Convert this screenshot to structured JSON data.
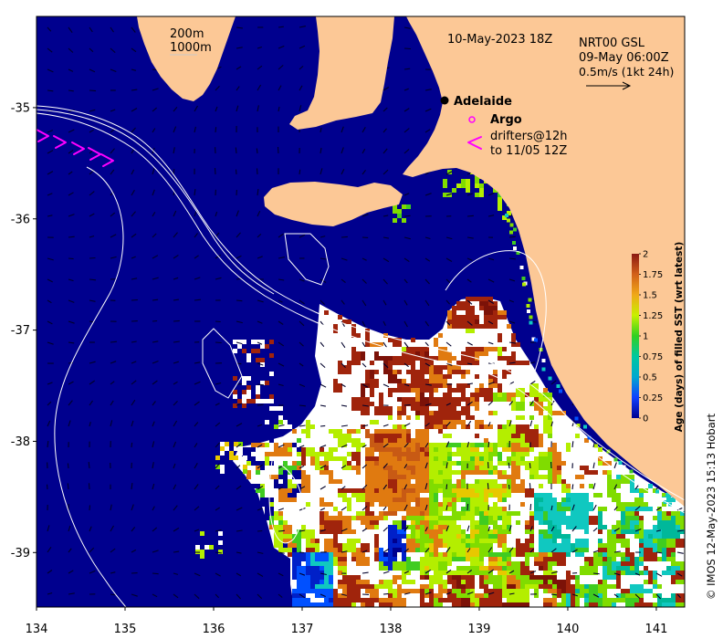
{
  "figure": {
    "date_label": "10-May-2023 18Z",
    "credit": "© IMOS 12-May-2023 15:13 Hobart"
  },
  "isobath_legend": {
    "shallow": "200m",
    "deep": "1000m"
  },
  "currents_legend": {
    "product": "NRT00 GSL",
    "time": "09-May 06:00Z",
    "scale": "0.5m/s (1kt 24h)"
  },
  "places": {
    "city": "Adelaide"
  },
  "floats_legend": {
    "argo": "Argo",
    "drifters_line1": "drifters@12h",
    "drifters_line2": "to 11/05 12Z"
  },
  "axes": {
    "lon_range": [
      134,
      141.32
    ],
    "lat_range": [
      -39.49,
      -34.18
    ],
    "x_ticks": [
      134,
      135,
      136,
      137,
      138,
      139,
      140,
      141
    ],
    "y_ticks": [
      -35,
      -36,
      -37,
      -38,
      -39
    ]
  },
  "colorbar": {
    "label": "Age (days) of filled SST (wrt latest)",
    "range": [
      0,
      2
    ],
    "ticks": [
      "2",
      "1.75",
      "1.5",
      "1.25",
      "1",
      "0.75",
      "0.5",
      "0.25",
      "0"
    ],
    "colors": [
      "#8b1a12",
      "#d2601a",
      "#f0a818",
      "#c8f000",
      "#30d020",
      "#00c8a0",
      "#00a8d0",
      "#1040ff",
      "#000090"
    ]
  },
  "colors": {
    "ocean": "#00008e",
    "land": "#fcc896",
    "no_data": "#ffffff",
    "contour": "#ffffff",
    "legend_line": "#c8c8c8",
    "argo": "#ff00ff",
    "drifter": "#ff00ff",
    "city_marker": "#000000",
    "current_arrow": "#00002a"
  },
  "sst_palette": {
    "dark_brown": "#7c1208",
    "brown": "#a0240c",
    "orange": "#e07a10",
    "dark_orange": "#c85a14",
    "yellow": "#e8c800",
    "yellow_green": "#b4ee00",
    "light_green": "#80dc00",
    "green": "#40cc20",
    "teal": "#00b89a",
    "cyan": "#10c8c0",
    "blue": "#0050ff",
    "deep_blue": "#0020c8"
  }
}
